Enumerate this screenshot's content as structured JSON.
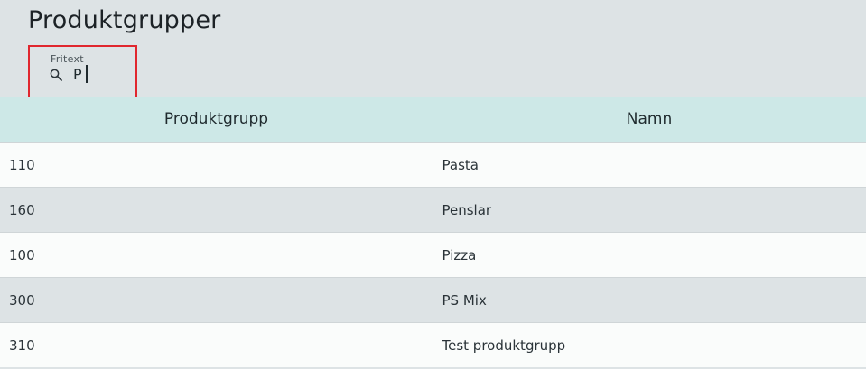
{
  "page": {
    "title": "Produktgrupper"
  },
  "search": {
    "label": "Fritext",
    "value": "P",
    "icon": "search-icon"
  },
  "table": {
    "columns": [
      "Produktgrupp",
      "Namn"
    ],
    "rows": [
      {
        "produktgrupp": "110",
        "namn": "Pasta"
      },
      {
        "produktgrupp": "160",
        "namn": "Penslar"
      },
      {
        "produktgrupp": "100",
        "namn": "Pizza"
      },
      {
        "produktgrupp": "300",
        "namn": "PS Mix"
      },
      {
        "produktgrupp": "310",
        "namn": "Test produktgrupp"
      }
    ]
  },
  "colors": {
    "background": "#dde3e5",
    "header_row": "#cde8e7",
    "row_light": "#fafcfb",
    "highlight_border": "#e0262e"
  }
}
